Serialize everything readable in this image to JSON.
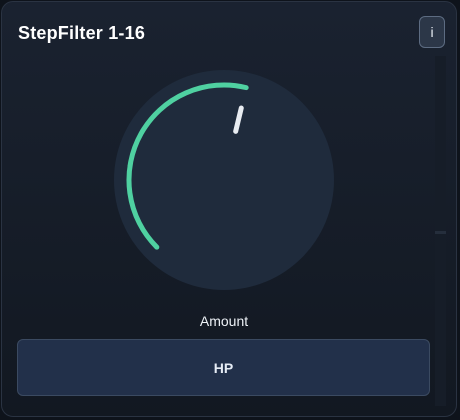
{
  "header": {
    "title": "StepFilter 1-16",
    "info_label": "i"
  },
  "knob": {
    "label": "Amount",
    "value": 0.55,
    "accent_color": "#4fd1a1",
    "body_color": "#1f2b3c",
    "pointer_color": "#e8ecf1"
  },
  "mode": {
    "label": "HP"
  }
}
